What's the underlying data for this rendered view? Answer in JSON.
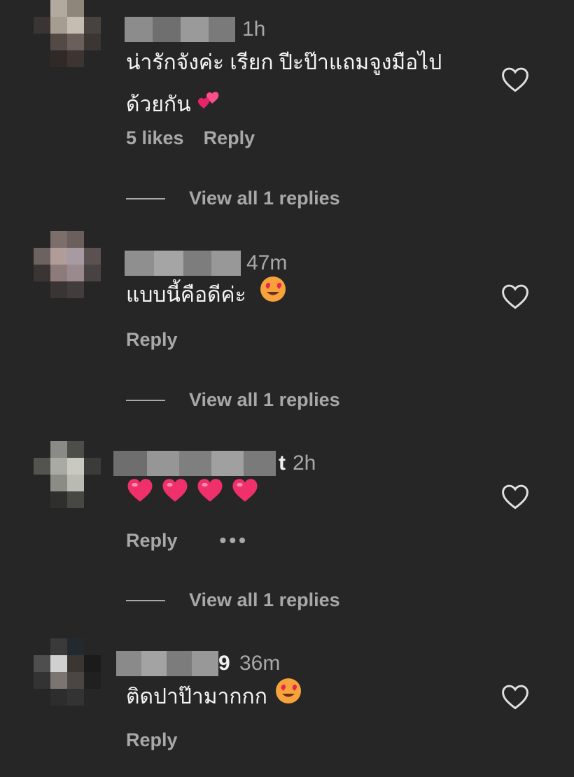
{
  "comments": [
    {
      "time": "1h",
      "text_line1": "น่ารักจังค่ะ เรียก ปีะป๊าแถมจูงมือไป",
      "text_line2": "ด้วยกัน",
      "likes": "5 likes",
      "reply": "Reply",
      "view_replies": "View all 1 replies"
    },
    {
      "time": "47m",
      "text": "แบบนี้คือดีค่ะ",
      "reply": "Reply",
      "view_replies": "View all 1 replies"
    },
    {
      "username_tail": "t",
      "time": "2h",
      "reply": "Reply",
      "more": "•••",
      "view_replies": "View all 1 replies"
    },
    {
      "username_tail": "9",
      "time": "36m",
      "text": "ติดปาป๊ามากกก",
      "reply": "Reply"
    }
  ],
  "icons": {
    "like": "heart-outline-icon",
    "hearts_emoji": "two-hearts-emoji",
    "heart_eyes_emoji": "heart-eyes-emoji",
    "red_heart_emoji": "red-heart-emoji"
  },
  "colors": {
    "background": "#262626",
    "primary_text": "#f5f5f5",
    "secondary_text": "#a8a8a8",
    "heart_pink": "#ff3d6e"
  }
}
